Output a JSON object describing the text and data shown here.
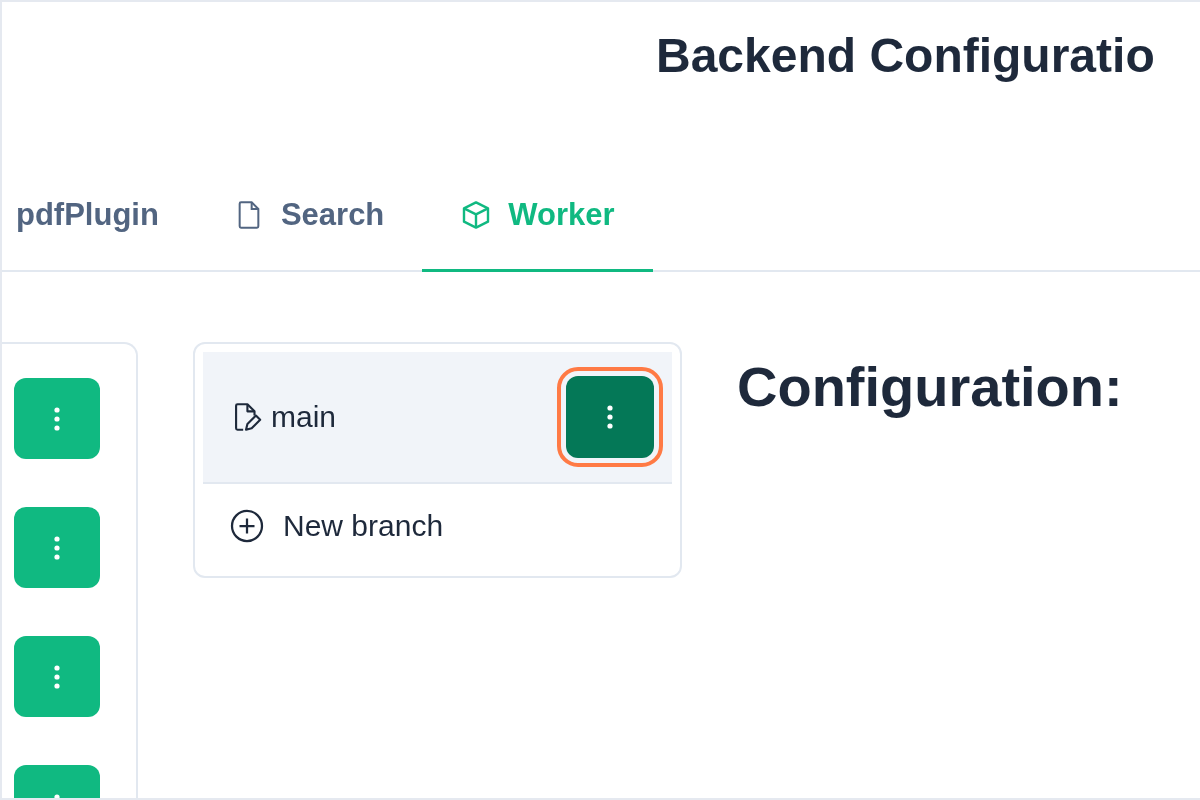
{
  "page_title": "Backend Configuratio",
  "tabs": [
    {
      "label": "pdfPlugin",
      "selected": false
    },
    {
      "label": "Search",
      "selected": false
    },
    {
      "label": "Worker",
      "selected": true
    }
  ],
  "branches": {
    "items": [
      {
        "name": "main",
        "selected": true,
        "menu_highlighted": true
      }
    ],
    "new_branch": "New branch"
  },
  "heading": "Configuration:"
}
